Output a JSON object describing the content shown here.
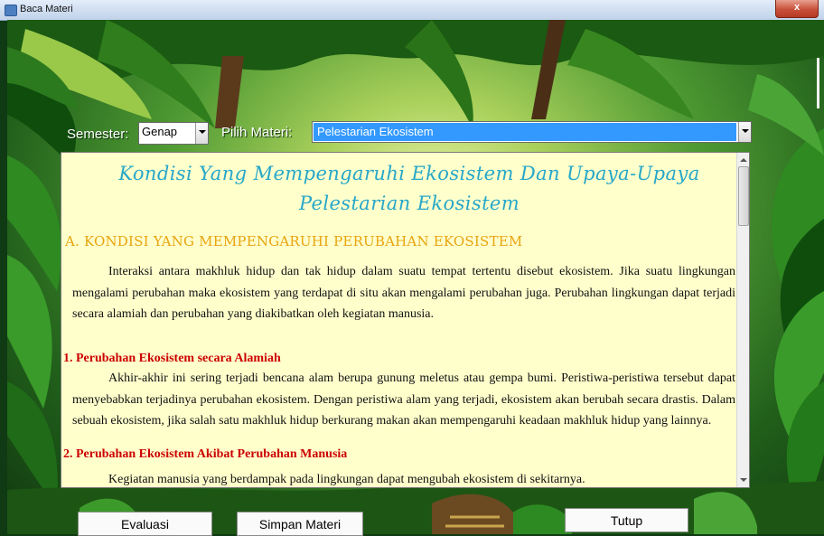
{
  "window": {
    "title": "Baca Materi",
    "close_glyph": "x"
  },
  "controls": {
    "semester_label": "Semester:",
    "semester_value": "Genap",
    "materi_label": "Pilih Materi:",
    "materi_value": "Pelestarian Ekosistem"
  },
  "document": {
    "title": "Kondisi Yang Mempengaruhi Ekosistem Dan Upaya-Upaya Pelestarian Ekosistem",
    "section_a": "A. KONDISI YANG MEMPENGARUHI PERUBAHAN EKOSISTEM",
    "paragraph_1": "Interaksi antara makhluk hidup dan tak hidup dalam suatu tempat tertentu disebut ekosistem. Jika suatu lingkungan mengalami perubahan maka ekosistem yang terdapat di situ akan mengalami perubahan juga. Perubahan lingkungan dapat terjadi secara alamiah dan perubahan yang diakibatkan oleh kegiatan manusia.",
    "subheading_1": "1.  Perubahan Ekosistem secara Alamiah",
    "paragraph_2": "Akhir-akhir ini sering terjadi bencana alam berupa gunung meletus atau gempa bumi. Peristiwa-peristiwa tersebut dapat menyebabkan terjadinya perubahan ekosistem. Dengan peristiwa alam yang terjadi, ekosistem akan berubah secara drastis. Dalam sebuah ekosistem, jika salah satu makhluk hidup berkurang makan akan mempengaruhi keadaan makhluk hidup yang lainnya.",
    "subheading_2": "2.  Perubahan Ekosistem Akibat Perubahan Manusia",
    "paragraph_3": "Kegiatan manusia yang berdampak pada lingkungan dapat mengubah ekosistem di sekitarnya."
  },
  "buttons": {
    "evaluasi": "Evaluasi",
    "simpan": "Simpan Materi",
    "tutup": "Tutup"
  },
  "colors": {
    "title_cyan": "#27a7c9",
    "section_orange": "#e8a40e",
    "subheading_red": "#cc0000",
    "page_bg": "#ffffcc",
    "selection_blue": "#3399ff"
  }
}
